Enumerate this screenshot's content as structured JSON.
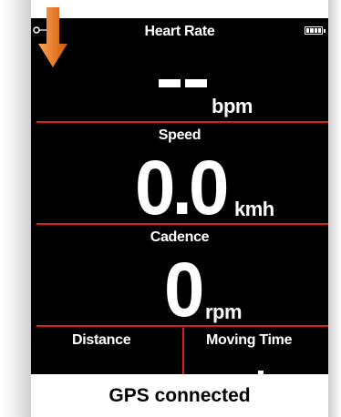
{
  "header": {
    "title": "Heart Rate",
    "battery_icon": "battery-full-icon",
    "status_icon": "gps-link-icon"
  },
  "heart_rate": {
    "value": "--",
    "unit": "bpm"
  },
  "speed": {
    "label": "Speed",
    "value": "0.0",
    "unit": "kmh"
  },
  "cadence": {
    "label": "Cadence",
    "value": "0",
    "unit": "rpm"
  },
  "distance": {
    "label": "Distance"
  },
  "moving_time": {
    "label": "Moving Time"
  },
  "toast": {
    "message": "GPS connected"
  },
  "colors": {
    "background": "#000000",
    "divider": "#d81e1e",
    "text": "#ffffff",
    "arrow": "#e87a2a"
  }
}
